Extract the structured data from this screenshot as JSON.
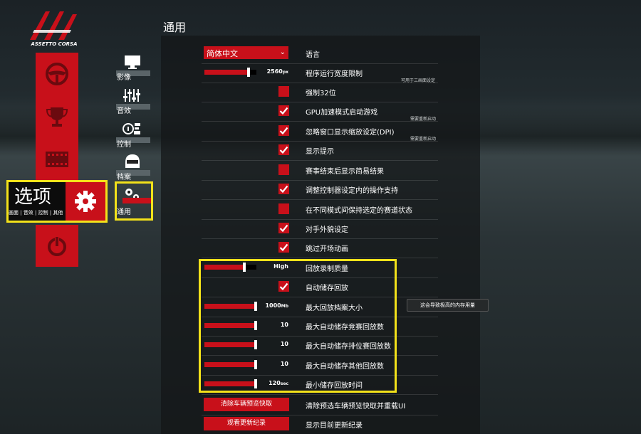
{
  "brand": {
    "logo_text": "ASSETTO CORSA"
  },
  "page_title": "通用",
  "main_nav": {
    "items": [
      {
        "icon": "steering-wheel-icon"
      },
      {
        "icon": "trophy-icon"
      },
      {
        "icon": "film-strip-icon"
      },
      {
        "icon": "gear-icon"
      },
      {
        "icon": "power-icon"
      }
    ],
    "options_title": "选项",
    "options_subtitle": "画面 | 音效 | 控制 | 其他"
  },
  "sub_nav": {
    "items": [
      {
        "label": "影像",
        "icon": "monitor-icon"
      },
      {
        "label": "音效",
        "icon": "sliders-icon"
      },
      {
        "label": "控制",
        "icon": "controls-icon"
      },
      {
        "label": "档案",
        "icon": "driver-helmet-icon"
      },
      {
        "label": "通用",
        "icon": "gears-icon"
      }
    ]
  },
  "settings": {
    "language": {
      "value": "简体中文",
      "label": "语言"
    },
    "fps_limit": {
      "value": "2560",
      "unit": "px",
      "label": "程序运行宽度限制",
      "note": "可用于三画面设定",
      "level": 0.86
    },
    "force32": {
      "label": "强制32位",
      "checked": false
    },
    "gpu_accel": {
      "label": "GPU加速模式启动游戏",
      "checked": true,
      "note": "需要重新启动"
    },
    "ignore_dpi": {
      "label": "忽略窗口显示缩放设定(DPI)",
      "checked": true,
      "note": "需要重新启动"
    },
    "show_hints": {
      "label": "显示提示",
      "checked": true
    },
    "simple_results": {
      "label": "赛事结束后显示简易结果",
      "checked": false
    },
    "controller_support": {
      "label": "调整控制器设定内的操作支持",
      "checked": true
    },
    "keep_track_state": {
      "label": "在不同模式间保持选定的赛道状态",
      "checked": false
    },
    "opponent_setup": {
      "label": "对手外貌设定",
      "checked": true
    },
    "skip_intro": {
      "label": "跳过开场动画",
      "checked": true
    },
    "replay_quality": {
      "label": "回放录制质量",
      "value": "High",
      "level": 0.78
    },
    "auto_save_replay": {
      "label": "自动储存回放",
      "checked": true
    },
    "max_replay_size": {
      "label": "最大回放档案大小",
      "value": "1000",
      "unit": "Mb",
      "level": 1.0,
      "tooltip": "这会导致极高的内存用量"
    },
    "max_race_replays": {
      "label": "最大自动储存竞赛回放数",
      "value": "10",
      "level": 1.0
    },
    "max_quali_replays": {
      "label": "最大自动储存排位赛回放数",
      "value": "10",
      "level": 1.0
    },
    "max_other_replays": {
      "label": "最大自动储存其他回放数",
      "value": "10",
      "level": 1.0
    },
    "min_replay_time": {
      "label": "最小储存回放时间",
      "value": "120",
      "unit": "sec",
      "level": 1.0
    },
    "clear_cache": {
      "button": "清除车辆预览快取",
      "label": "清除预选车辆预览快取并重载UI"
    },
    "changelog": {
      "button": "观看更新纪录",
      "label": "显示目前更新纪录"
    }
  }
}
